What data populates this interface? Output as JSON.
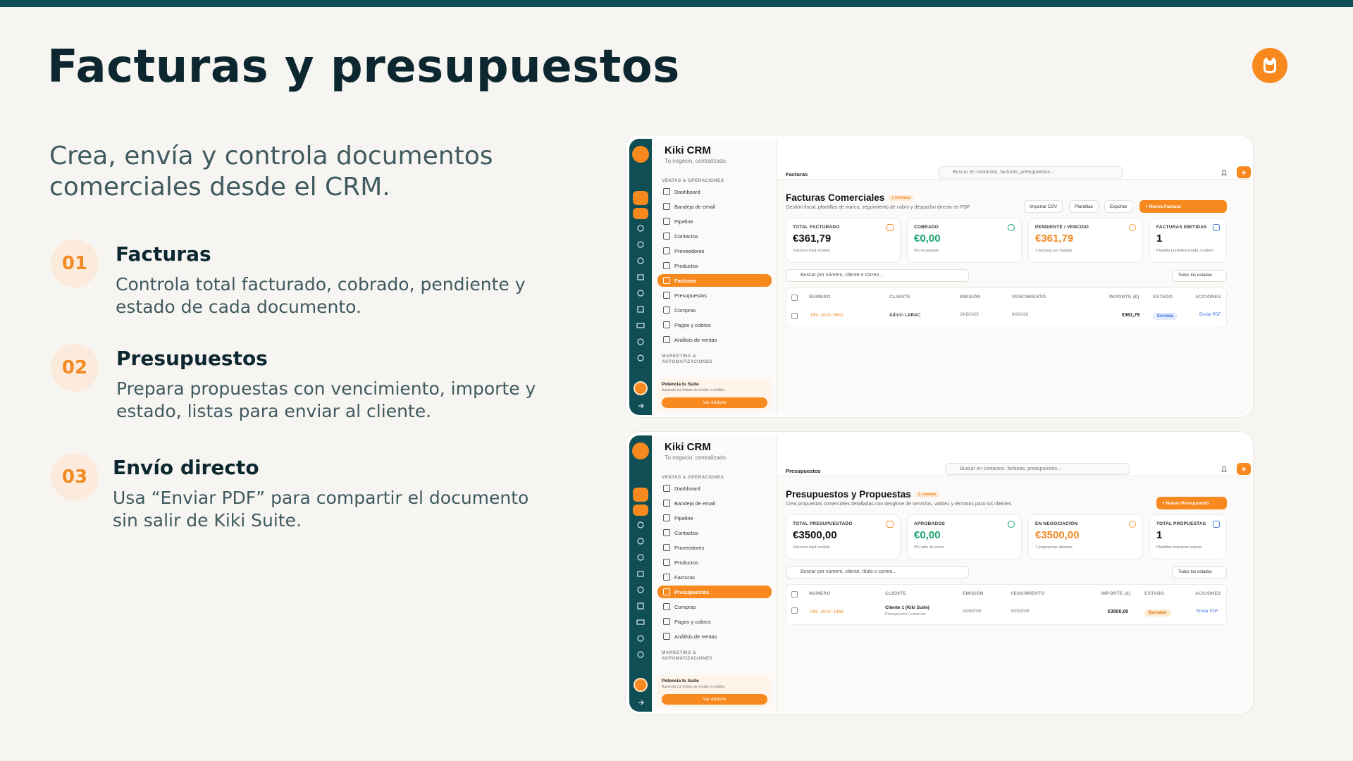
{
  "slide": {
    "title": "Facturas y presupuestos",
    "subtitle": "Crea, envía y controla documentos comerciales desde el CRM.",
    "features": [
      {
        "num": "01",
        "title": "Facturas",
        "desc": "Controla total facturado, cobrado, pendiente y estado de cada documento."
      },
      {
        "num": "02",
        "title": "Presupuestos",
        "desc": "Prepara propuestas con vencimiento, importe y estado, listas para enviar al cliente."
      },
      {
        "num": "03",
        "title": "Envío directo",
        "desc": "Usa “Enviar PDF” para compartir el documento sin salir de Kiki Suite."
      }
    ]
  },
  "colors": {
    "accent": "#f7891e",
    "dark_teal": "#0f4e55",
    "title": "#0d2730",
    "text": "#3f5a60"
  },
  "crm": {
    "brand": "Kiki CRM",
    "tagline": "Tu negocio, centralizado.",
    "section_sales": "VENTAS & OPERACIONES",
    "section_marketing_1": "MARKETING &",
    "section_marketing_2": "AUTOMATIZACIONES",
    "search_placeholder": "Buscar en contactos, facturas, presupuestos...",
    "promo_title": "Potencia tu Suite",
    "promo_sub": "Aumenta tus límites de emails o créditos",
    "promo_button": "Ver Addons",
    "nav_f": [
      "Dashboard",
      "Bandeja de email",
      "Pipeline",
      "Contactos",
      "Proveedores",
      "Productos",
      "Facturas",
      "Presupuestos",
      "Compras",
      "Pagos y cobros",
      "Análisis de ventas"
    ],
    "nav_p": [
      "Dashboard",
      "Bandeja de email",
      "Pipeline",
      "Contactos",
      "Proveedores",
      "Productos",
      "Facturas",
      "Presupuestos",
      "Compras",
      "Pagos y cobros",
      "Análisis de ventas"
    ]
  },
  "invoices": {
    "page": "Facturas",
    "title": "Facturas Comerciales",
    "badge": "1 emitidas",
    "desc": "Gestión fiscal, plantillas de marca, seguimiento de cobro y despacho directo en PDF.",
    "btn_import": "Importar CSV",
    "btn_templates": "Plantillas",
    "btn_export": "Exportar",
    "btn_new": "+ Nueva Factura",
    "cards": [
      {
        "label": "TOTAL FACTURADO",
        "value": "€361,79",
        "sub": "Volumen total emitido",
        "color": "#111111"
      },
      {
        "label": "COBRADO",
        "value": "€0,00",
        "sub": "0% recaudado",
        "color": "#1aa36b"
      },
      {
        "label": "PENDIENTE / VENCIDO",
        "value": "€361,79",
        "sub": "1 facturas por liquidar",
        "color": "#f28a24"
      },
      {
        "label": "FACTURAS EMITIDAS",
        "value": "1",
        "sub": "Plantilla predeterminada: modern",
        "color": "#111111"
      }
    ],
    "filter_placeholder": "Buscar por número, cliente o correo...",
    "filter_select": "Todos los estados",
    "columns": [
      "NÚMERO",
      "CLIENTE",
      "EMISIÓN",
      "VENCIMIENTO",
      "IMPORTE (€)",
      "ESTADO",
      "ACCIONES"
    ],
    "row": {
      "number": "INV-2026-0001",
      "client": "Admin LABAC",
      "issued": "24/8/2026",
      "due": "8/9/2026",
      "amount": "€361,79",
      "status": "Enviada",
      "action": "Enviar PDF"
    }
  },
  "quotes": {
    "page": "Presupuestos",
    "title": "Presupuestos y Propuestas",
    "badge": "1 creados",
    "desc": "Crea propuestas comerciales detalladas con desglose de servicios, validez y términos para tus clientes.",
    "btn_new": "+ Nuevo Presupuesto",
    "cards": [
      {
        "label": "TOTAL PRESUPUESTADO",
        "value": "€3500,00",
        "sub": "Volumen total emitido",
        "color": "#111111"
      },
      {
        "label": "APROBADOS",
        "value": "€0,00",
        "sub": "0% ratio de cierre",
        "color": "#1aa36b"
      },
      {
        "label": "EN NEGOCIACIÓN",
        "value": "€3500,00",
        "sub": "1 propuestas abiertas",
        "color": "#f28a24"
      },
      {
        "label": "TOTAL PROPUESTAS",
        "value": "1",
        "sub": "Plantillas maestras activas",
        "color": "#111111"
      }
    ],
    "filter_placeholder": "Buscar por número, cliente, título o correo...",
    "filter_select": "Todos los estados",
    "columns": [
      "NÚMERO",
      "CLIENTE",
      "EMISIÓN",
      "VENCIMIENTO",
      "IMPORTE (€)",
      "ESTADO",
      "ACCIONES"
    ],
    "row": {
      "number": "PRE-2026-2468",
      "client": "Cliente 1 (Kiki Suite)",
      "client_sub": "Presupuesto Comercial",
      "issued": "31/8/2026",
      "due": "30/9/2026",
      "amount": "€3500,00",
      "status": "Borrador",
      "action": "Enviar PDF"
    }
  }
}
